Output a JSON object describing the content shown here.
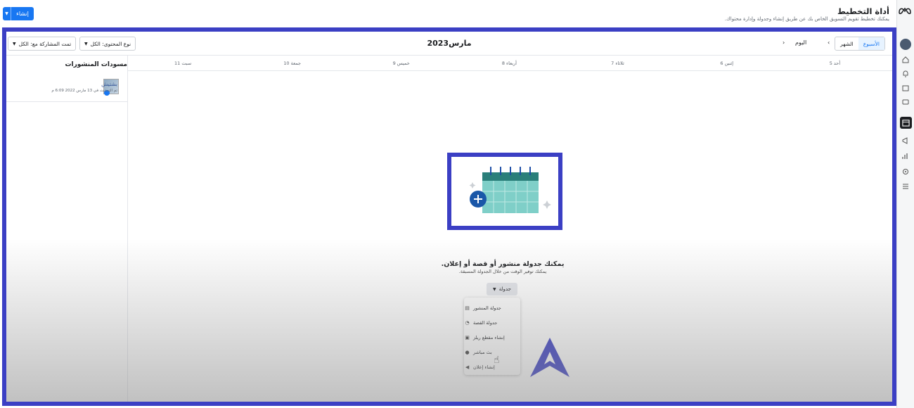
{
  "header": {
    "title": "أداة التخطيط",
    "subtitle": "يمكنك تخطيط تقويم التسويق الخاص بك عن طريق إنشاء وجدولة وإدارة محتواك.",
    "create_label": "إنشاء"
  },
  "toolbar": {
    "month_label": "مارس2023",
    "views": [
      "الأسبوع",
      "الشهر"
    ],
    "active_view": "الأسبوع",
    "today_label": "اليوم",
    "content_type_filter": "نوع المحتوى: الكل",
    "shared_with_filter": "تمت المشاركة مع: الكل"
  },
  "drafts": {
    "heading": "مسودات المنشورات",
    "items": [
      {
        "name": "بشتيش",
        "updated": "تم التحديث في 13 مارس 2022 6:09 م"
      }
    ]
  },
  "week_days": [
    "أحد 5",
    "إثنين 6",
    "ثلاثاء 7",
    "أربعاء 8",
    "خميس 9",
    "جمعة 10",
    "سبت 11"
  ],
  "empty_state": {
    "title": "يمكنك جدولة منشور أو قصة أو إعلان.",
    "subtitle": "يمكنك توفير الوقت من خلال الجدولة المسبقة.",
    "schedule_label": "جدولة"
  },
  "schedule_menu": [
    {
      "label": "جدولة المنشور",
      "icon": "post-icon"
    },
    {
      "label": "جدولة القصة",
      "icon": "story-icon"
    },
    {
      "label": "إنشاء مقطع ريلز",
      "icon": "reel-icon"
    },
    {
      "label": "بث مباشر",
      "icon": "live-icon"
    },
    {
      "label": "إنشاء إعلان",
      "icon": "ad-icon"
    }
  ],
  "colors": {
    "accent": "#1877f2",
    "highlight_frame": "#3b3fc4",
    "calendar_teal": "#7fcfc8",
    "calendar_dark": "#2a7f7a"
  }
}
